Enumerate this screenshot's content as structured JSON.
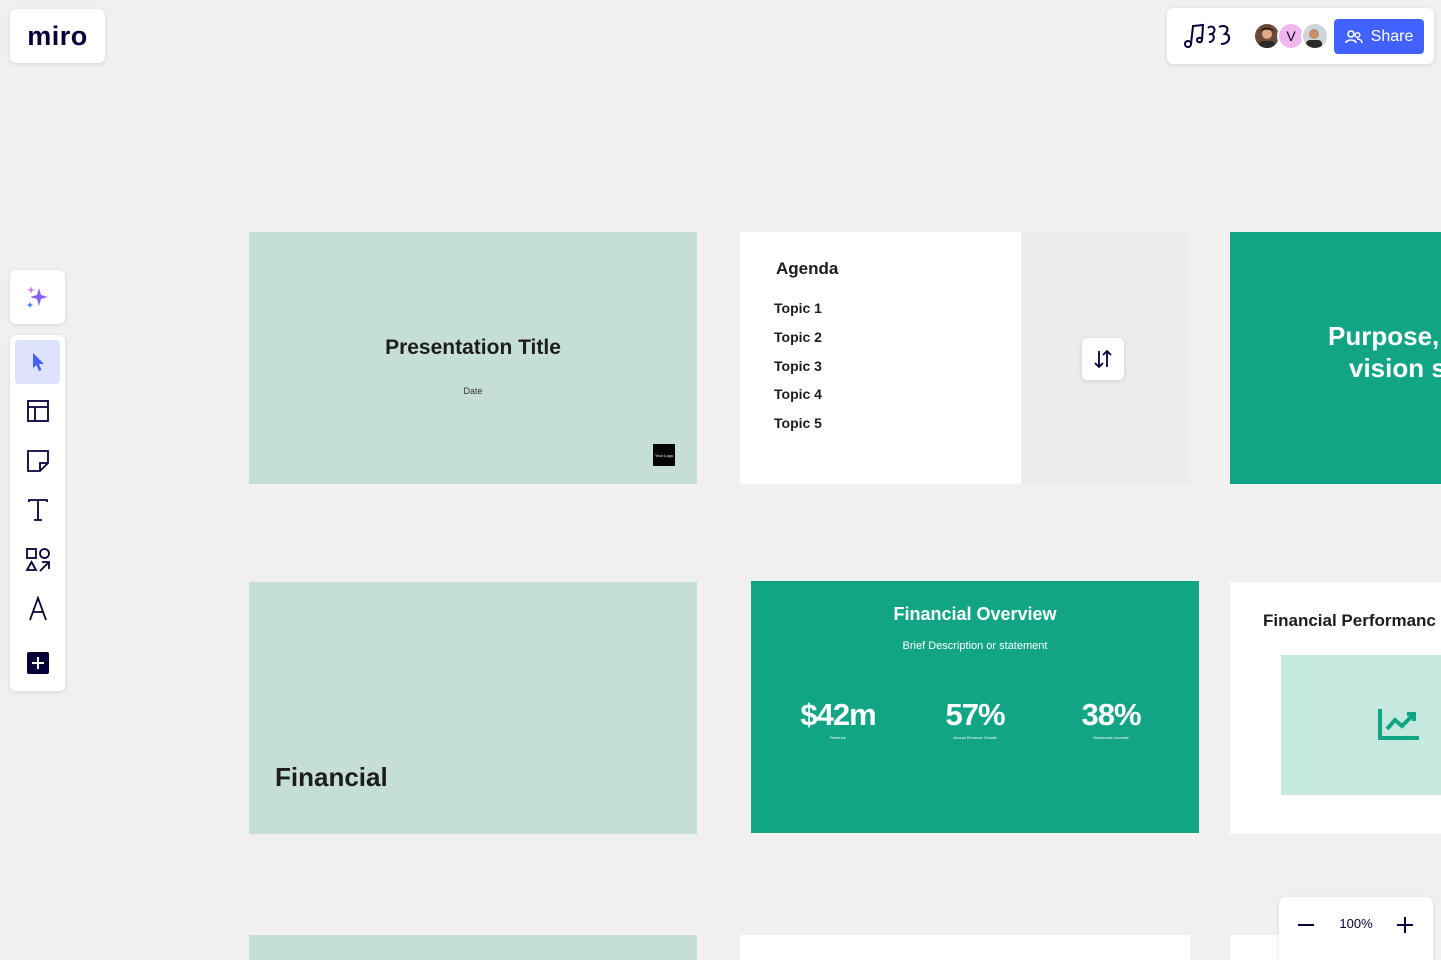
{
  "app": {
    "logo_text": "miro"
  },
  "topbar": {
    "reactions_icon": "reactions-icon",
    "avatar_initial": "V",
    "share_label": "Share",
    "share_icon": "users-icon",
    "share_color": "#4262ff"
  },
  "toolbar": {
    "ai_icon": "sparkles-icon",
    "tools": [
      "select-tool",
      "templates-tool",
      "sticky-note-tool",
      "text-tool",
      "shapes-tool",
      "pen-tool",
      "add-tool"
    ]
  },
  "frames": {
    "title_slide": {
      "title": "Presentation Title",
      "date": "Date",
      "logo_text": "Your Logo"
    },
    "agenda": {
      "heading": "Agenda",
      "topics": [
        "Topic 1",
        "Topic 2",
        "Topic 3",
        "Topic 4",
        "Topic 5"
      ]
    },
    "purpose": {
      "line1": "Purpose,",
      "line2": "vision s"
    },
    "financial": {
      "heading": "Financial"
    },
    "financial_overview": {
      "title": "Financial Overview",
      "subtitle": "Brief Description or statement",
      "stats": [
        {
          "value": "$42m",
          "label": "Revenue"
        },
        {
          "value": "57%",
          "label": "Annual Revenue Growth"
        },
        {
          "value": "38%",
          "label": "Headcount Increase"
        }
      ]
    },
    "financial_performance": {
      "title": "Financial Performanc",
      "chart_icon": "trend-chart-icon"
    }
  },
  "zoom": {
    "value": "100%"
  },
  "colors": {
    "accent_green": "#12a585",
    "light_green": "#c5dfd6",
    "brand": "#050038"
  }
}
